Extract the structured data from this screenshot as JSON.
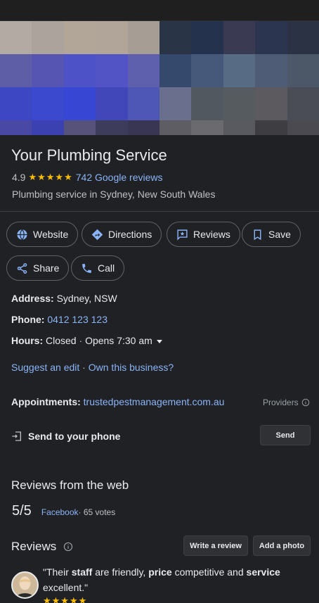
{
  "business": {
    "name": "Your Plumbing Service",
    "rating": "4.9",
    "stars": "★★★★★",
    "reviews_link": "742 Google reviews",
    "category": "Plumbing service in Sydney, New South Wales"
  },
  "photo_tiles": [
    "#b3aaa4",
    "#ada39d",
    "#b2a698",
    "#b1a599",
    "#a69d95",
    "#2a3447",
    "#24324d",
    "#3a3a52",
    "#2c3550",
    "#2b3244",
    "#5e5ea6",
    "#5656b2",
    "#4d52c7",
    "#5253c4",
    "#5f60ad",
    "#34496b",
    "#47597a",
    "#576b84",
    "#4e5d75",
    "#4c5868",
    "#3e47c3",
    "#3b49cf",
    "#3747d3",
    "#4146b8",
    "#4e56b6",
    "#6b6f8e",
    "#52585f",
    "#565b60",
    "#5c5a5e",
    "#4a4c56",
    "#4a48a5",
    "#3b41b1",
    "#56527a",
    "#3d3c5a",
    "#383652",
    "#5d5d63",
    "#6b6a6e",
    "#595960",
    "#3d3d42",
    "#4a4a50"
  ],
  "actions": [
    {
      "label": "Website",
      "icon": "globe-icon"
    },
    {
      "label": "Directions",
      "icon": "directions-icon"
    },
    {
      "label": "Reviews",
      "icon": "reviews-icon"
    },
    {
      "label": "Save",
      "icon": "bookmark-icon"
    },
    {
      "label": "Share",
      "icon": "share-icon"
    },
    {
      "label": "Call",
      "icon": "phone-icon"
    }
  ],
  "details": {
    "address_label": "Address:",
    "address": "Sydney, NSW",
    "phone_label": "Phone:",
    "phone": "0412 123 123",
    "hours_label": "Hours:",
    "hours_status": "Closed",
    "hours_sep": " · ",
    "hours_next": "Opens 7:30 am",
    "suggest_edit": "Suggest an edit",
    "dot": " · ",
    "own_business": "Own this business?",
    "appointments_label": "Appointments:",
    "appointments_link": "trustedpestmanagement.com.au",
    "providers": "Providers",
    "send_to_phone": "Send to your phone",
    "send_button": "Send"
  },
  "web_reviews": {
    "title": "Reviews from the web",
    "score": "5/5",
    "source": "Facebook",
    "votes": " · 65 votes"
  },
  "reviews": {
    "title": "Reviews",
    "write_review": "Write a review",
    "add_photo": "Add a photo",
    "q_open": "\"Their ",
    "w1": "staff",
    "t1": " are friendly, ",
    "w2": "price",
    "t2": " competitive and ",
    "w3": "service",
    "t3": "excellent.\"",
    "stars": "★★★★★"
  },
  "colors": {
    "background": "#202124",
    "link": "#8ab4f8",
    "star": "#fbbc04",
    "border": "#5f6368"
  }
}
